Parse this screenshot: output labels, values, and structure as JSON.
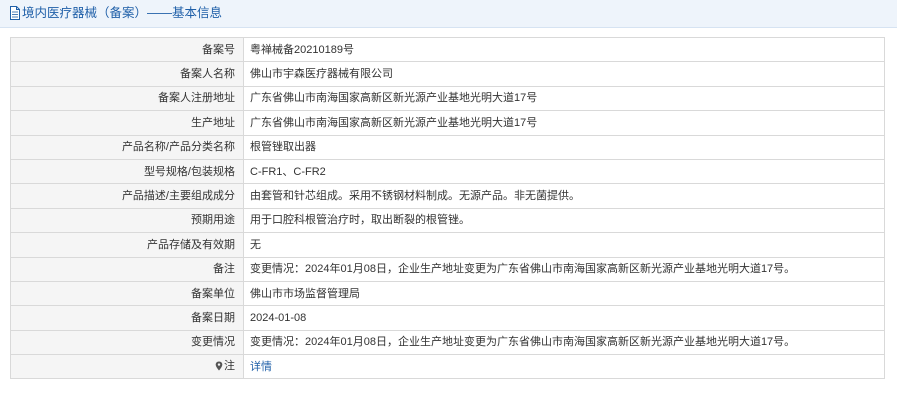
{
  "header": {
    "title": "境内医疗器械（备案）——基本信息",
    "icon": "document-icon"
  },
  "rows": [
    {
      "label": "备案号",
      "value": "粤禅械备20210189号"
    },
    {
      "label": "备案人名称",
      "value": "佛山市宇森医疗器械有限公司"
    },
    {
      "label": "备案人注册地址",
      "value": "广东省佛山市南海国家高新区新光源产业基地光明大道17号"
    },
    {
      "label": "生产地址",
      "value": "广东省佛山市南海国家高新区新光源产业基地光明大道17号"
    },
    {
      "label": "产品名称/产品分类名称",
      "value": "根管锉取出器"
    },
    {
      "label": "型号规格/包装规格",
      "value": "C-FR1、C-FR2"
    },
    {
      "label": "产品描述/主要组成成分",
      "value": "由套管和针芯组成。采用不锈钢材料制成。无源产品。非无菌提供。"
    },
    {
      "label": "预期用途",
      "value": "用于口腔科根管治疗时，取出断裂的根管锉。"
    },
    {
      "label": "产品存储及有效期",
      "value": "无"
    },
    {
      "label": "备注",
      "value": "变更情况：2024年01月08日，企业生产地址变更为广东省佛山市南海国家高新区新光源产业基地光明大道17号。"
    },
    {
      "label": "备案单位",
      "value": "佛山市市场监督管理局"
    },
    {
      "label": "备案日期",
      "value": "2024-01-08"
    },
    {
      "label": "变更情况",
      "value": "变更情况：2024年01月08日，企业生产地址变更为广东省佛山市南海国家高新区新光源产业基地光明大道17号。"
    }
  ],
  "note_row": {
    "label": "注",
    "icon": "map-pin-icon",
    "link": "详情"
  },
  "colors": {
    "accent": "#1f5fa8",
    "header_bg": "#eef4fb",
    "label_bg": "#f5f5f5",
    "border": "#d9d9d9"
  }
}
